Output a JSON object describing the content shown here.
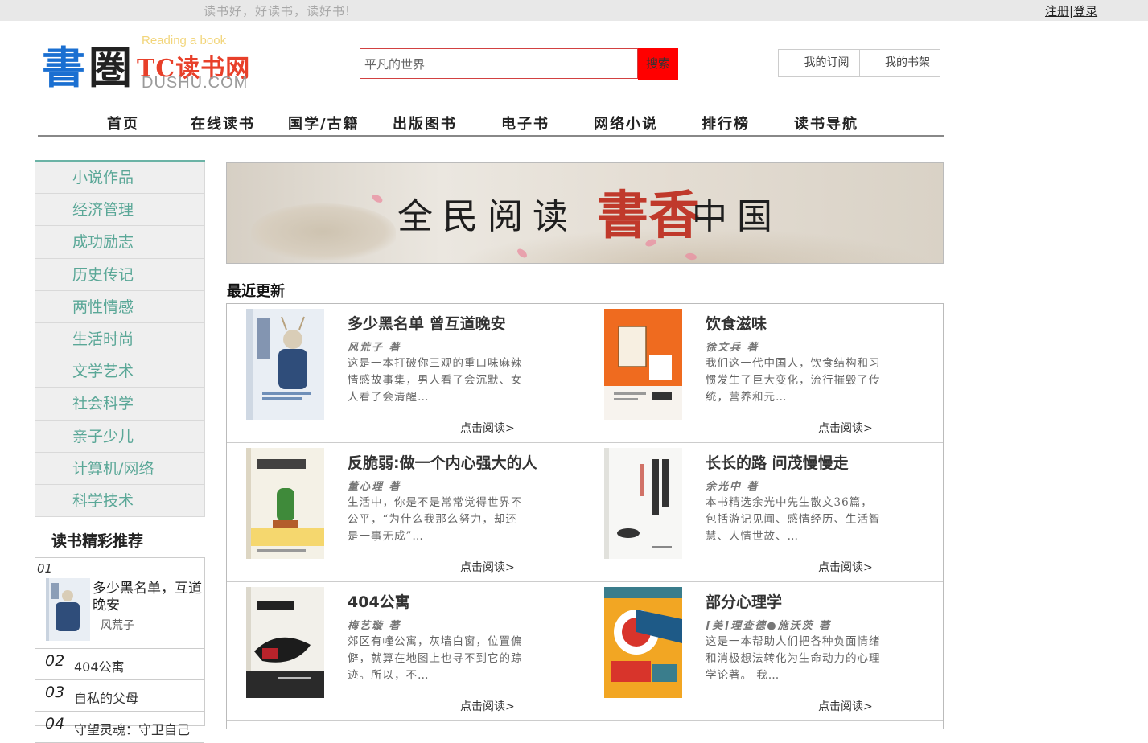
{
  "topbar": {
    "slogan": "读书好，好读书，读好书!",
    "register": "注册",
    "separator": "|",
    "login": "登录"
  },
  "logo": {
    "calligraphy_1": "書",
    "calligraphy_2": "圏",
    "reading": "Reading a book",
    "brand": "TC读书网",
    "domain": "DUSHU.COM"
  },
  "search": {
    "value": "平凡的世界",
    "button": "搜索"
  },
  "user": {
    "subscribe": "我的订阅",
    "shelf": "我的书架"
  },
  "nav": [
    "首页",
    "在线读书",
    "国学/古籍",
    "出版图书",
    "电子书",
    "网络小说",
    "排行榜",
    "读书导航"
  ],
  "categories": [
    "小说作品",
    "经济管理",
    "成功励志",
    "历史传记",
    "两性情感",
    "生活时尚",
    "文学艺术",
    "社会科学",
    "亲子少儿",
    "计算机/网络",
    "科学技术"
  ],
  "recommend": {
    "title": "读书精彩推荐",
    "first": {
      "num": "01",
      "title": "多少黑名单，互道晚安",
      "author": "风荒子"
    },
    "rows": [
      {
        "num": "02",
        "title": "404公寓"
      },
      {
        "num": "03",
        "title": "自私的父母"
      },
      {
        "num": "04",
        "title": "守望灵魂：守卫自己"
      }
    ]
  },
  "banner": {
    "left": "全民阅读",
    "highlight": "書香",
    "right_char": "中国"
  },
  "recent": {
    "title": "最近更新",
    "read_label": "点击阅读>",
    "books": [
      {
        "title": "多少黑名单 曾互道晚安",
        "author": "风荒子 著",
        "desc": "这是一本打破你三观的重口味麻辣情感故事集，男人看了会沉默、女人看了会清醒…",
        "cover_bg": "#e9eef4",
        "cover_accent": "#2f4d7a"
      },
      {
        "title": "饮食滋味",
        "author": "徐文兵 著",
        "desc": "我们这一代中国人，饮食结构和习惯发生了巨大变化，流行摧毁了传统，营养和元…",
        "cover_bg": "#ef6b1f",
        "cover_accent": "#ffffff"
      },
      {
        "title": "反脆弱:做一个内心强大的人",
        "author": "董心理 著",
        "desc": "生活中，你是不是常常觉得世界不公平，“为什么我那么努力，却还是一事无成”…",
        "cover_bg": "#f4f1e6",
        "cover_accent": "#3f8a3a"
      },
      {
        "title": "长长的路 问茂慢慢走",
        "author": "余光中 著",
        "desc": "本书精选余光中先生散文36篇，包括游记见闻、感情经历、生活智慧、人情世故、…",
        "cover_bg": "#f7f7f5",
        "cover_accent": "#333333"
      },
      {
        "title": "404公寓",
        "author": "梅艺璇 著",
        "desc": "郊区有幢公寓，灰墙白窗，位置偏僻，就算在地图上也寻不到它的踪迹。所以，不…",
        "cover_bg": "#f2f0ea",
        "cover_accent": "#b8232b"
      },
      {
        "title": "部分心理学",
        "author": "[美]理查德●施沃茨 著",
        "desc": "这是一本帮助人们把各种负面情绪和消极想法转化为生命动力的心理学论著。 我…",
        "cover_bg": "#f2a623",
        "cover_accent": "#d8342b"
      }
    ]
  }
}
